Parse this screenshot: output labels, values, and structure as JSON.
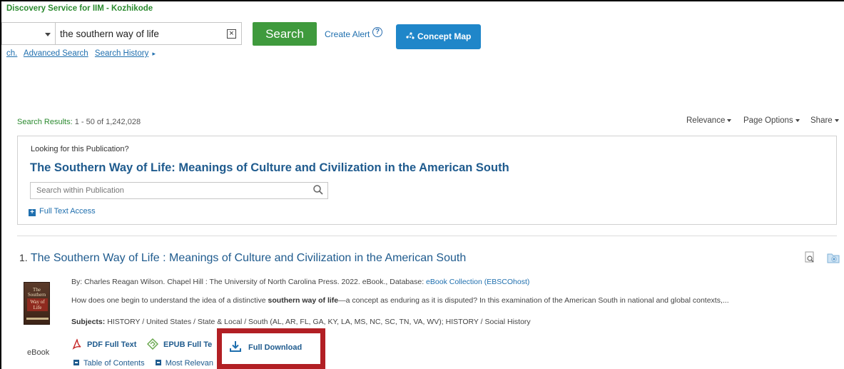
{
  "header": {
    "service_title": "Discovery Service for IIM - Kozhikode",
    "search_query": "the southern way of life",
    "clear_glyph": "×",
    "search_button": "Search",
    "create_alert": "Create Alert",
    "help_glyph": "?",
    "concept_map": "Concept Map",
    "links": [
      "ch.",
      "Advanced Search",
      "Search History"
    ],
    "history_arrow": "▸"
  },
  "results_bar": {
    "label": "Search Results:",
    "range": "1 - 50 of 1,242,028",
    "relevance": "Relevance",
    "page_options": "Page Options",
    "share": "Share"
  },
  "publication": {
    "looking": "Looking for this Publication?",
    "title": "The Southern Way of Life: Meanings of Culture and Civilization in the American South",
    "search_placeholder": "Search within Publication",
    "full_text_access": "Full Text Access"
  },
  "result": {
    "number": "1.",
    "title": "The Southern Way of Life : Meanings of Culture and Civilization in the American South",
    "byline_pre": "By: Charles Reagan Wilson. Chapel Hill : The University of North Carolina Press. 2022. eBook., Database: ",
    "database": "eBook Collection (EBSCOhost)",
    "abstract_pre": "How does one begin to understand the idea of a distinctive ",
    "abstract_bold": "southern way of life",
    "abstract_post": "—a concept as enduring as it is disputed? In this examination of the American South in national and global contexts,...",
    "subjects_label": "Subjects:",
    "subjects": "HISTORY / United States / State & Local / South (AL, AR, FL, GA, KY, LA, MS, NC, SC, TN, VA, WV); HISTORY / Social History",
    "type_label": "eBook",
    "cover": {
      "line1": "The",
      "line2": "Southern",
      "line3": "Way of",
      "line4": "Life"
    },
    "pdf_full_text": "PDF Full Text",
    "epub_full_text": "EPUB Full Te",
    "full_download": "Full Download",
    "table_of_contents": "Table of Contents",
    "most_relevant": "Most Relevan"
  },
  "colors": {
    "accent_green": "#3f9a3d",
    "link_blue": "#1f6fae",
    "concept_blue": "#1f86c9",
    "highlight_red": "#b21f24"
  }
}
